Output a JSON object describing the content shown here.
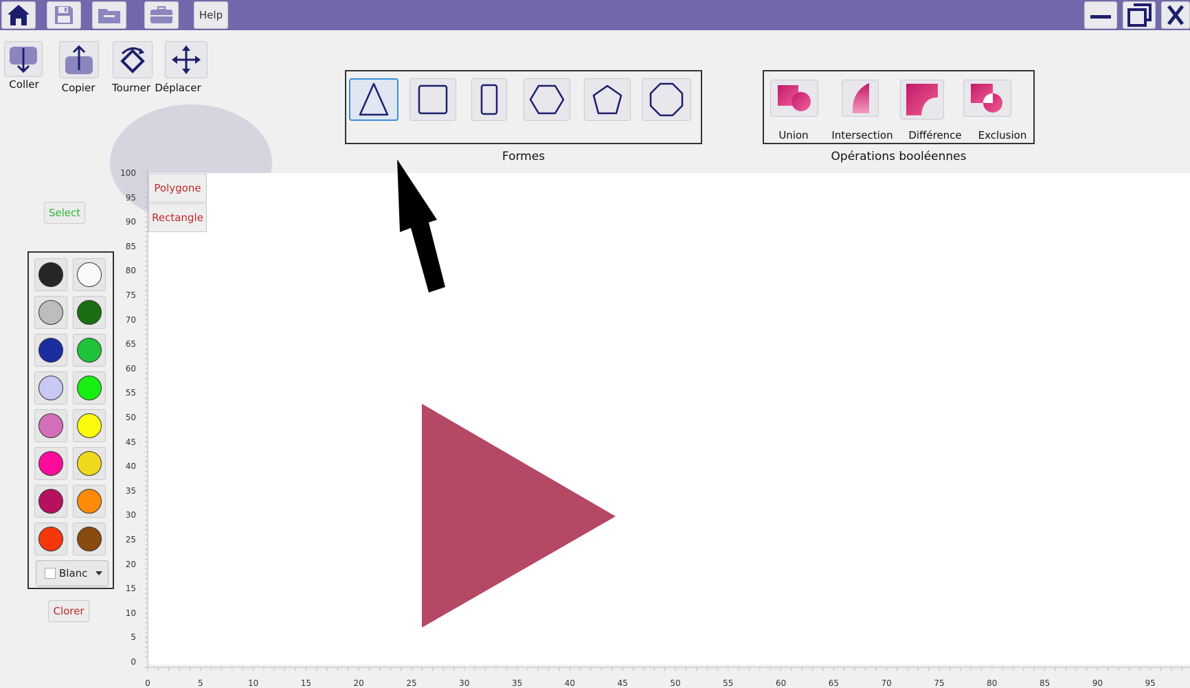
{
  "titlebar": {
    "help_label": "Help",
    "icons": [
      "home-icon",
      "save-icon",
      "folder-icon",
      "briefcase-icon"
    ],
    "color": "#7169ab"
  },
  "toolbar": {
    "paste_label": "Coller",
    "copy_label": "Copier",
    "rotate_label": "Tourner",
    "move_label": "Déplacer"
  },
  "shapes": {
    "title": "Formes",
    "items": [
      "triangle",
      "square",
      "rectangle",
      "hexagon",
      "pentagon",
      "octagon"
    ],
    "selected": "triangle"
  },
  "boolean_ops": {
    "title": "Opérations booléennes",
    "union": "Union",
    "intersection": "Intersection",
    "difference": "Différence",
    "exclusion": "Exclusion"
  },
  "left_panel": {
    "select_label": "Select",
    "clear_label": "Clorer",
    "color_dropdown_value": "Blanc",
    "colors": [
      "#262626",
      "#fafafa",
      "#bdbdbd",
      "#1b6e12",
      "#1a2ea0",
      "#1fc23a",
      "#c7c8f3",
      "#17ef12",
      "#d36fb8",
      "#fbfb0b",
      "#ff0b9b",
      "#efd91c",
      "#b5115f",
      "#ff8a0a",
      "#f5370b",
      "#8a4b0e"
    ]
  },
  "canvas": {
    "tab_polygon": "Polygone",
    "tab_rectangle": "Rectangle",
    "y_ticks": [
      "100",
      "95",
      "90",
      "85",
      "80",
      "75",
      "70",
      "65",
      "60",
      "55",
      "50",
      "45",
      "40",
      "35",
      "30",
      "25",
      "20",
      "15",
      "10",
      "5",
      "0"
    ],
    "x_ticks": [
      "0",
      "5",
      "10",
      "15",
      "20",
      "25",
      "30",
      "35",
      "40",
      "45",
      "50",
      "55",
      "60",
      "65",
      "70",
      "75",
      "80",
      "85",
      "90",
      "95"
    ],
    "shape_color": "#b44865"
  }
}
